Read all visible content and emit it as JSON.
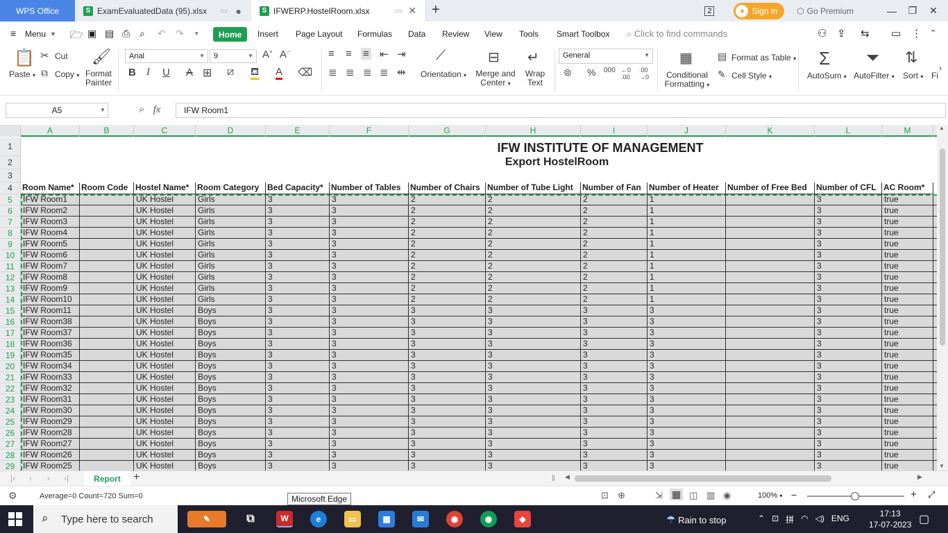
{
  "tabs": {
    "wps": "WPS Office",
    "file1": "ExamEvaluatedData (95).xlsx",
    "file2": "IFWERP.HostelRoom.xlsx",
    "signin": "Sign in",
    "premium": "Go Premium",
    "counter": "2"
  },
  "menu": {
    "menu": "Menu",
    "items": [
      "Home",
      "Insert",
      "Page Layout",
      "Formulas",
      "Data",
      "Review",
      "View",
      "Tools",
      "Smart Toolbox"
    ],
    "find": "Click to find commands"
  },
  "ribbon": {
    "paste": "Paste",
    "cut": "Cut",
    "copy": "Copy",
    "format_painter_1": "Format",
    "format_painter_2": "Painter",
    "font": "Arial",
    "size": "9",
    "orientation": "Orientation",
    "merge_1": "Merge and",
    "merge_2": "Center",
    "wrap_1": "Wrap",
    "wrap_2": "Text",
    "number_format": "General",
    "cond_1": "Conditional",
    "cond_2": "Formatting",
    "format_table": "Format as Table",
    "cell_style": "Cell Style",
    "autosum": "AutoSum",
    "autofilter": "AutoFilter",
    "sort": "Sort",
    "fill": "Fi"
  },
  "formula_bar": {
    "name_box": "A5",
    "formula": "IFW Room1"
  },
  "sheet": {
    "title": "IFW INSTITUTE OF MANAGEMENT",
    "subtitle": "Export HostelRoom",
    "columns": [
      "A",
      "B",
      "C",
      "D",
      "E",
      "F",
      "G",
      "H",
      "I",
      "J",
      "K",
      "L",
      "M"
    ],
    "headers": [
      "Room Name*",
      "Room Code",
      "Hostel Name*",
      "Room Category",
      "Bed Capacity*",
      "Number of Tables",
      "Number of Chairs",
      "Number of Tube Light",
      "Number of Fan",
      "Number of Heater",
      "Number of Free Bed",
      "Number of CFL",
      "AC Room*"
    ],
    "row_numbers": [
      "1",
      "2",
      "3",
      "4",
      "5",
      "6",
      "7",
      "8",
      "9",
      "10",
      "11",
      "12",
      "13",
      "14",
      "15",
      "16",
      "17",
      "18",
      "19",
      "20",
      "21",
      "22",
      "23",
      "24",
      "25",
      "26",
      "27",
      "28",
      "29"
    ],
    "rows": [
      [
        "IFW Room1",
        "",
        "UK Hostel",
        "Girls",
        "3",
        "3",
        "2",
        "2",
        "2",
        "1",
        "",
        "3",
        "true"
      ],
      [
        "IFW Room2",
        "",
        "UK Hostel",
        "Girls",
        "3",
        "3",
        "2",
        "2",
        "2",
        "1",
        "",
        "3",
        "true"
      ],
      [
        "IFW Room3",
        "",
        "UK Hostel",
        "Girls",
        "3",
        "3",
        "2",
        "2",
        "2",
        "1",
        "",
        "3",
        "true"
      ],
      [
        "IFW Room4",
        "",
        "UK Hostel",
        "Girls",
        "3",
        "3",
        "2",
        "2",
        "2",
        "1",
        "",
        "3",
        "true"
      ],
      [
        "IFW Room5",
        "",
        "UK Hostel",
        "Girls",
        "3",
        "3",
        "2",
        "2",
        "2",
        "1",
        "",
        "3",
        "true"
      ],
      [
        "IFW Room6",
        "",
        "UK Hostel",
        "Girls",
        "3",
        "3",
        "2",
        "2",
        "2",
        "1",
        "",
        "3",
        "true"
      ],
      [
        "IFW Room7",
        "",
        "UK Hostel",
        "Girls",
        "3",
        "3",
        "2",
        "2",
        "2",
        "1",
        "",
        "3",
        "true"
      ],
      [
        "IFW Room8",
        "",
        "UK Hostel",
        "Girls",
        "3",
        "3",
        "2",
        "2",
        "2",
        "1",
        "",
        "3",
        "true"
      ],
      [
        "IFW Room9",
        "",
        "UK Hostel",
        "Girls",
        "3",
        "3",
        "2",
        "2",
        "2",
        "1",
        "",
        "3",
        "true"
      ],
      [
        "IFW Room10",
        "",
        "UK Hostel",
        "Girls",
        "3",
        "3",
        "2",
        "2",
        "2",
        "1",
        "",
        "3",
        "true"
      ],
      [
        "IFW Room11",
        "",
        "UK Hostel",
        "Boys",
        "3",
        "3",
        "3",
        "3",
        "3",
        "3",
        "",
        "3",
        "true"
      ],
      [
        "IFW Room38",
        "",
        "UK Hostel",
        "Boys",
        "3",
        "3",
        "3",
        "3",
        "3",
        "3",
        "",
        "3",
        "true"
      ],
      [
        "IFW Room37",
        "",
        "UK Hostel",
        "Boys",
        "3",
        "3",
        "3",
        "3",
        "3",
        "3",
        "",
        "3",
        "true"
      ],
      [
        "IFW Room36",
        "",
        "UK Hostel",
        "Boys",
        "3",
        "3",
        "3",
        "3",
        "3",
        "3",
        "",
        "3",
        "true"
      ],
      [
        "IFW Room35",
        "",
        "UK Hostel",
        "Boys",
        "3",
        "3",
        "3",
        "3",
        "3",
        "3",
        "",
        "3",
        "true"
      ],
      [
        "IFW Room34",
        "",
        "UK Hostel",
        "Boys",
        "3",
        "3",
        "3",
        "3",
        "3",
        "3",
        "",
        "3",
        "true"
      ],
      [
        "IFW Room33",
        "",
        "UK Hostel",
        "Boys",
        "3",
        "3",
        "3",
        "3",
        "3",
        "3",
        "",
        "3",
        "true"
      ],
      [
        "IFW Room32",
        "",
        "UK Hostel",
        "Boys",
        "3",
        "3",
        "3",
        "3",
        "3",
        "3",
        "",
        "3",
        "true"
      ],
      [
        "IFW Room31",
        "",
        "UK Hostel",
        "Boys",
        "3",
        "3",
        "3",
        "3",
        "3",
        "3",
        "",
        "3",
        "true"
      ],
      [
        "IFW Room30",
        "",
        "UK Hostel",
        "Boys",
        "3",
        "3",
        "3",
        "3",
        "3",
        "3",
        "",
        "3",
        "true"
      ],
      [
        "IFW Room29",
        "",
        "UK Hostel",
        "Boys",
        "3",
        "3",
        "3",
        "3",
        "3",
        "3",
        "",
        "3",
        "true"
      ],
      [
        "IFW Room28",
        "",
        "UK Hostel",
        "Boys",
        "3",
        "3",
        "3",
        "3",
        "3",
        "3",
        "",
        "3",
        "true"
      ],
      [
        "IFW Room27",
        "",
        "UK Hostel",
        "Boys",
        "3",
        "3",
        "3",
        "3",
        "3",
        "3",
        "",
        "3",
        "true"
      ],
      [
        "IFW Room26",
        "",
        "UK Hostel",
        "Boys",
        "3",
        "3",
        "3",
        "3",
        "3",
        "3",
        "",
        "3",
        "true"
      ],
      [
        "IFW Room25",
        "",
        "UK Hostel",
        "Boys",
        "3",
        "3",
        "3",
        "3",
        "3",
        "3",
        "",
        "3",
        "true"
      ]
    ],
    "sheet_tab": "Report"
  },
  "status": {
    "summary": "Average=0  Count=720  Sum=0",
    "tooltip": "Microsoft Edge",
    "zoom": "100%"
  },
  "taskbar": {
    "search": "Type here to search",
    "weather": "Rain to stop",
    "lang": "ENG",
    "time": "17:13",
    "date": "17-07-2023"
  },
  "colors": {
    "accent": "#1e9e52",
    "wps_blue": "#4a86e8",
    "cell_gray": "#d9d9d9"
  }
}
